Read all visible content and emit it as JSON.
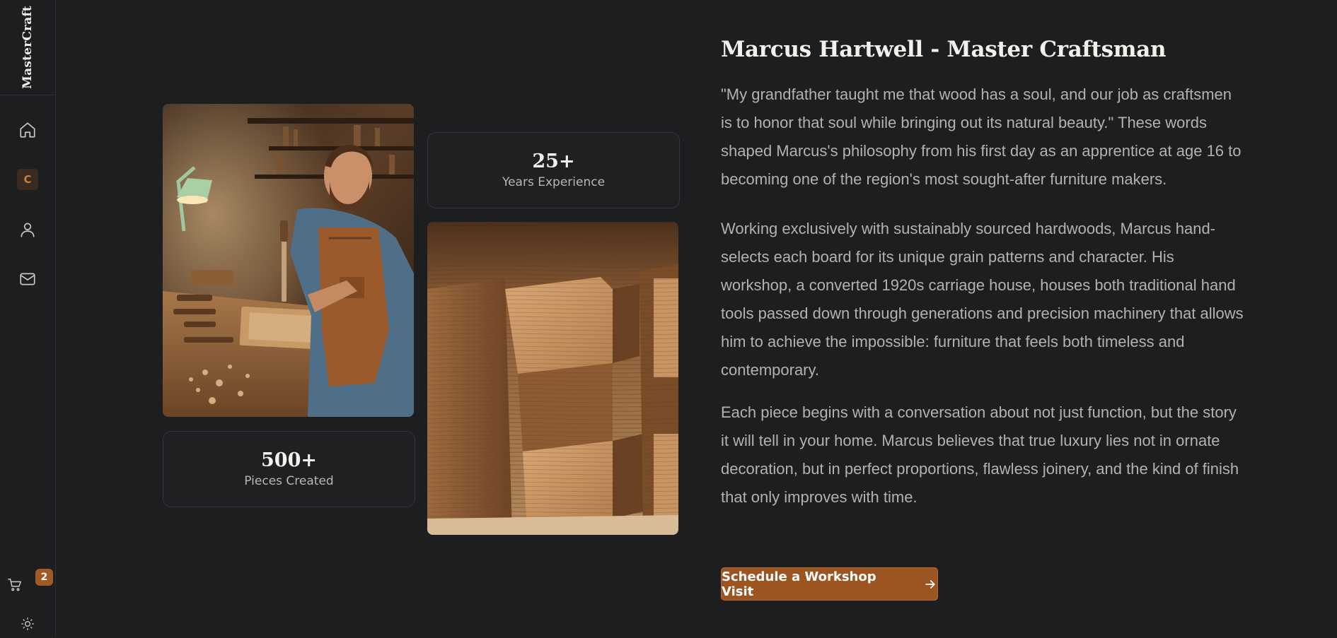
{
  "sidebar": {
    "brand": "MasterCraft",
    "nav": [
      {
        "name": "home",
        "icon": "home-icon"
      },
      {
        "name": "craftsmanship",
        "icon_letter": "C"
      },
      {
        "name": "profile",
        "icon": "user-icon"
      },
      {
        "name": "contact",
        "icon": "mail-icon"
      }
    ],
    "cart": {
      "icon": "cart-icon",
      "count": "2"
    },
    "theme_toggle": {
      "icon": "sun-icon"
    }
  },
  "gallery": {
    "craftsman_photo": {
      "subject": "craftsman carving wood at workbench"
    },
    "joinery_photo": {
      "subject": "close-up of wooden finger joint"
    },
    "stats": [
      {
        "value": "25+",
        "label": "Years Experience"
      },
      {
        "value": "500+",
        "label": "Pieces Created"
      }
    ]
  },
  "about": {
    "title": "Marcus Hartwell - Master Craftsman",
    "paragraphs": [
      "\"My grandfather taught me that wood has a soul, and our job as craftsmen is to honor that soul while bringing out its natural beauty.\" These words shaped Marcus's philosophy from his first day as an apprentice at age 16 to becoming one of the region's most sought-after furniture makers.",
      "Working exclusively with sustainably sourced hardwoods, Marcus hand-selects each board for its unique grain patterns and character. His workshop, a converted 1920s carriage house, houses both traditional hand tools passed down through generations and precision machinery that allows him to achieve the impossible: furniture that feels both timeless and contemporary.",
      "Each piece begins with a conversation about not just function, but the story it will tell in your home. Marcus believes that true luxury lies not in ornate decoration, but in perfect proportions, flawless joinery, and the kind of finish that only improves with time."
    ],
    "cta_label": "Schedule a Workshop Visit"
  },
  "colors": {
    "background": "#1d1e20",
    "accent": "#9c5421",
    "text_muted": "#b4b2ae"
  }
}
